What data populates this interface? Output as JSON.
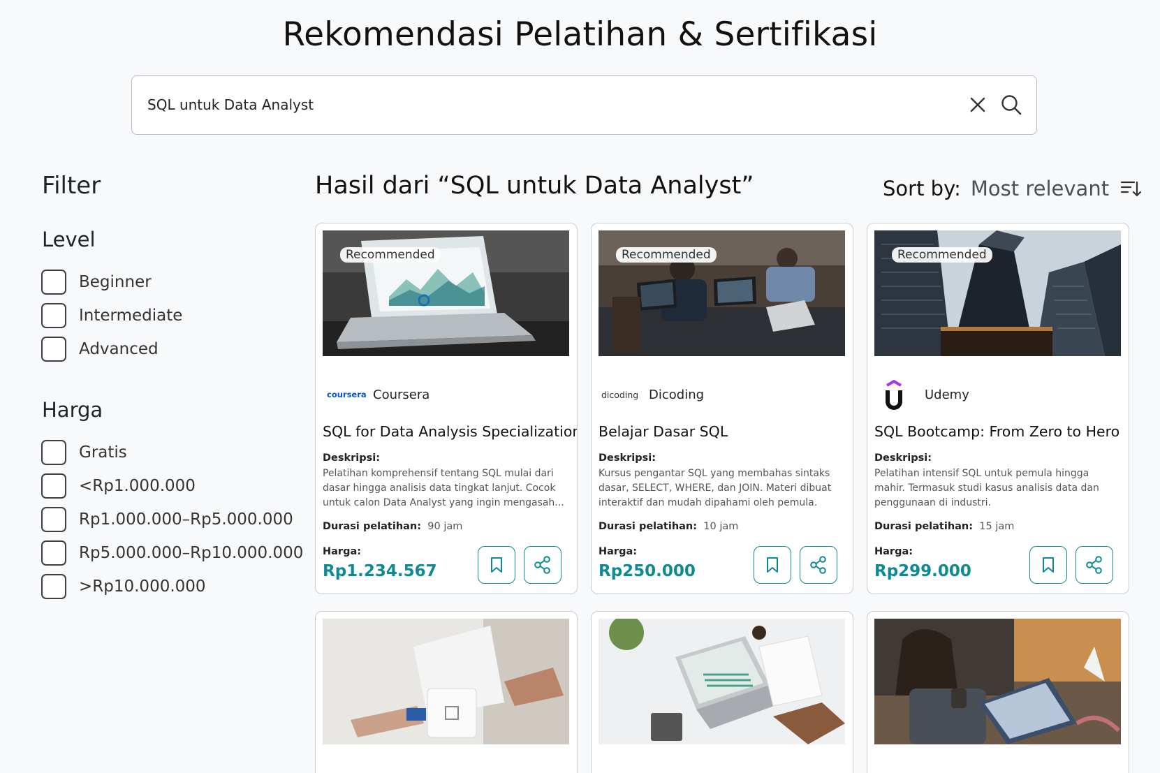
{
  "page": {
    "title": "Rekomendasi Pelatihan & Sertifikasi"
  },
  "search": {
    "value": "SQL untuk Data Analyst",
    "clear_icon": "close-icon",
    "search_icon": "search-icon"
  },
  "filters": {
    "title": "Filter",
    "level": {
      "title": "Level",
      "options": [
        "Beginner",
        "Intermediate",
        "Advanced"
      ]
    },
    "harga": {
      "title": "Harga",
      "options": [
        "Gratis",
        "<Rp1.000.000",
        "Rp1.000.000–Rp5.000.000",
        "Rp5.000.000–Rp10.000.000",
        ">Rp10.000.000"
      ]
    }
  },
  "results": {
    "title": "Hasil dari “SQL untuk Data Analyst”",
    "sort_label": "Sort by:",
    "sort_value": "Most relevant",
    "desc_label": "Deskripsi:",
    "duration_label": "Durasi pelatihan:",
    "price_label": "Harga:",
    "cards": [
      {
        "badge": "Recommended",
        "provider": "Coursera",
        "provider_logo_text": "coursera",
        "title": "SQL for Data Analysis Specialization",
        "description": "Pelatihan komprehensif tentang SQL mulai dari dasar hingga analisis data tingkat lanjut. Cocok untuk calon Data Analyst yang ingin mengasah...",
        "duration": "90 jam",
        "price": "Rp1.234.567"
      },
      {
        "badge": "Recommended",
        "provider": "Dicoding",
        "provider_logo_text": "dicoding",
        "title": "Belajar Dasar SQL",
        "description": "Kursus pengantar SQL yang membahas sintaks dasar, SELECT, WHERE, dan JOIN. Materi dibuat interaktif dan mudah dipahami oleh pemula.",
        "duration": "10 jam",
        "price": "Rp250.000"
      },
      {
        "badge": "Recommended",
        "provider": "Udemy",
        "provider_logo_text": "",
        "title": "SQL Bootcamp: From Zero to Hero",
        "description": "Pelatihan intensif SQL untuk pemula hingga mahir. Termasuk studi kasus analisis data dan penggunaan di industri.",
        "duration": "15 jam",
        "price": "Rp299.000"
      }
    ]
  },
  "colors": {
    "accent": "#0d8a93",
    "background": "#f8f9fb",
    "coursera": "#0056d2",
    "udemy": "#a435f0"
  }
}
